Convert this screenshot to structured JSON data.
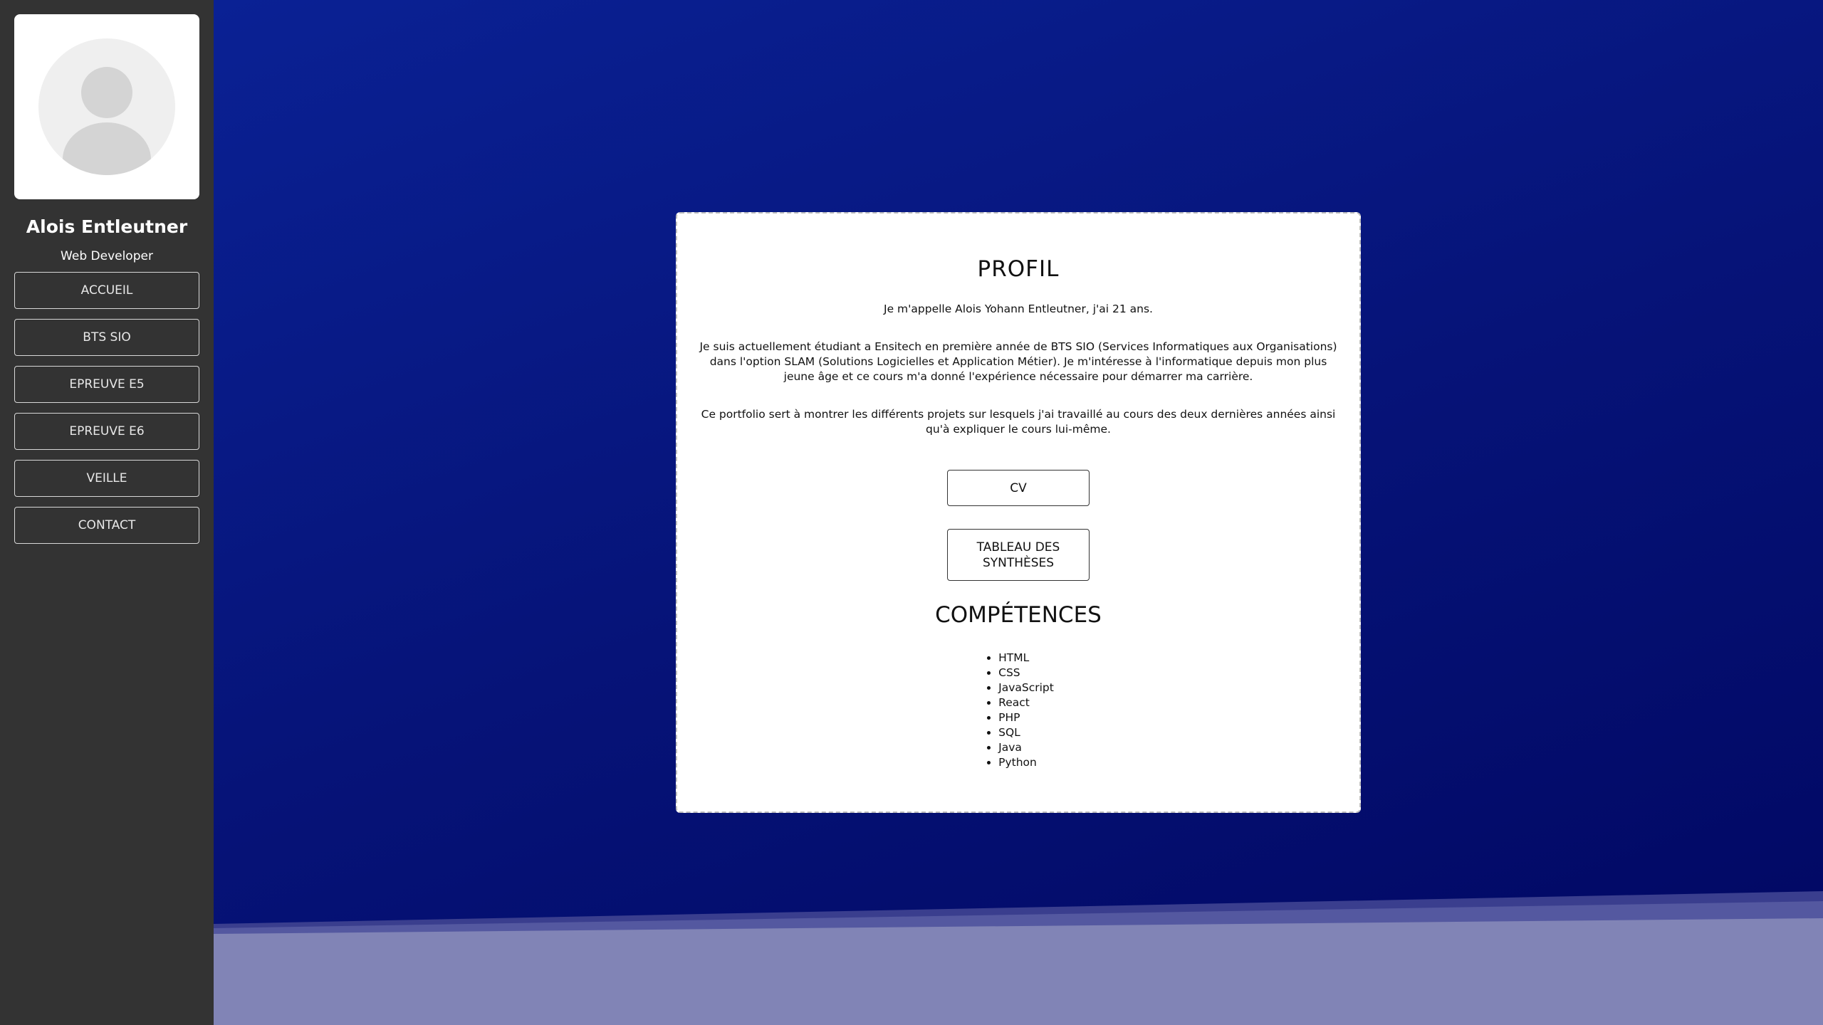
{
  "sidebar": {
    "name": "Alois Entleutner",
    "role": "Web Developer",
    "nav": [
      {
        "label": "ACCUEIL"
      },
      {
        "label": "BTS SIO"
      },
      {
        "label": "EPREUVE E5"
      },
      {
        "label": "EPREUVE E6"
      },
      {
        "label": "VEILLE"
      },
      {
        "label": "CONTACT"
      }
    ]
  },
  "card": {
    "title": "PROFIL",
    "intro": "Je m'appelle Alois Yohann Entleutner, j'ai 21 ans.",
    "paragraph1": "Je suis actuellement étudiant a Ensitech en première année de BTS SIO (Services Informatiques aux Organisations) dans l'option SLAM (Solutions Logicielles et Application Métier). Je m'intéresse à l'informatique depuis mon plus jeune âge et ce cours m'a donné l'expérience nécessaire pour démarrer ma carrière.",
    "paragraph2": "Ce portfolio sert à montrer les différents projets sur lesquels j'ai travaillé au cours des deux dernières années ainsi qu'à expliquer le cours lui-même.",
    "cv_button": "CV",
    "synthesis_button": "TABLEAU DES SYNTHÈSES",
    "skills_title": "COMPÉTENCES",
    "skills": [
      "HTML",
      "CSS",
      "JavaScript",
      "React",
      "PHP",
      "SQL",
      "Java",
      "Python"
    ]
  },
  "colors": {
    "sidebar_bg": "#333333",
    "main_bg_top": "#0a2194",
    "main_bg_bottom": "#010762",
    "wave_light": "#8184b6",
    "wave_mid": "#5458a0",
    "card_bg": "#ffffff"
  },
  "icons": {
    "avatar": "default-user-avatar-icon"
  }
}
